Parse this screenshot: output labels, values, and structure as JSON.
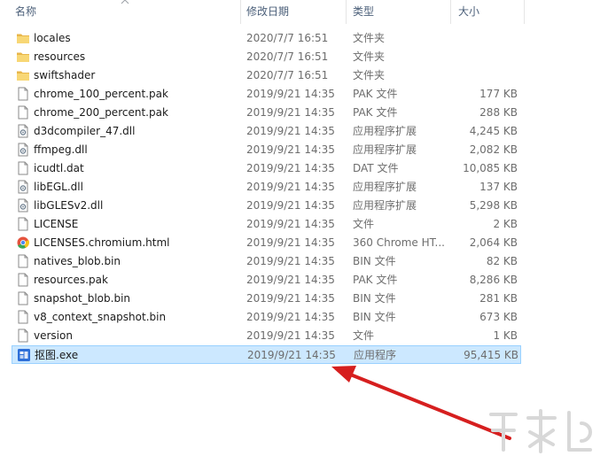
{
  "columns": {
    "name": "名称",
    "date": "修改日期",
    "type": "类型",
    "size": "大小"
  },
  "files": [
    {
      "name": "locales",
      "date": "2020/7/7 16:51",
      "type": "文件夹",
      "size": "",
      "icon": "folder-icon"
    },
    {
      "name": "resources",
      "date": "2020/7/7 16:51",
      "type": "文件夹",
      "size": "",
      "icon": "folder-icon"
    },
    {
      "name": "swiftshader",
      "date": "2020/7/7 16:51",
      "type": "文件夹",
      "size": "",
      "icon": "folder-icon"
    },
    {
      "name": "chrome_100_percent.pak",
      "date": "2019/9/21 14:35",
      "type": "PAK 文件",
      "size": "177 KB",
      "icon": "file-icon"
    },
    {
      "name": "chrome_200_percent.pak",
      "date": "2019/9/21 14:35",
      "type": "PAK 文件",
      "size": "288 KB",
      "icon": "file-icon"
    },
    {
      "name": "d3dcompiler_47.dll",
      "date": "2019/9/21 14:35",
      "type": "应用程序扩展",
      "size": "4,245 KB",
      "icon": "dll-icon"
    },
    {
      "name": "ffmpeg.dll",
      "date": "2019/9/21 14:35",
      "type": "应用程序扩展",
      "size": "2,082 KB",
      "icon": "dll-icon"
    },
    {
      "name": "icudtl.dat",
      "date": "2019/9/21 14:35",
      "type": "DAT 文件",
      "size": "10,085 KB",
      "icon": "file-icon"
    },
    {
      "name": "libEGL.dll",
      "date": "2019/9/21 14:35",
      "type": "应用程序扩展",
      "size": "137 KB",
      "icon": "dll-icon"
    },
    {
      "name": "libGLESv2.dll",
      "date": "2019/9/21 14:35",
      "type": "应用程序扩展",
      "size": "5,298 KB",
      "icon": "dll-icon"
    },
    {
      "name": "LICENSE",
      "date": "2019/9/21 14:35",
      "type": "文件",
      "size": "2 KB",
      "icon": "file-icon"
    },
    {
      "name": "LICENSES.chromium.html",
      "date": "2019/9/21 14:35",
      "type": "360 Chrome HT...",
      "size": "2,064 KB",
      "icon": "chrome-html-icon"
    },
    {
      "name": "natives_blob.bin",
      "date": "2019/9/21 14:35",
      "type": "BIN 文件",
      "size": "82 KB",
      "icon": "file-icon"
    },
    {
      "name": "resources.pak",
      "date": "2019/9/21 14:35",
      "type": "PAK 文件",
      "size": "8,286 KB",
      "icon": "file-icon"
    },
    {
      "name": "snapshot_blob.bin",
      "date": "2019/9/21 14:35",
      "type": "BIN 文件",
      "size": "281 KB",
      "icon": "file-icon"
    },
    {
      "name": "v8_context_snapshot.bin",
      "date": "2019/9/21 14:35",
      "type": "BIN 文件",
      "size": "673 KB",
      "icon": "file-icon"
    },
    {
      "name": "version",
      "date": "2019/9/21 14:35",
      "type": "文件",
      "size": "1 KB",
      "icon": "file-icon"
    },
    {
      "name": "抠图.exe",
      "date": "2019/9/21 14:35",
      "type": "应用程序",
      "size": "95,415 KB",
      "icon": "app-exe-icon",
      "selected": true
    }
  ],
  "colors": {
    "selection_bg": "#cce8ff",
    "selection_border": "#99d1ff",
    "arrow": "#d61f1f",
    "folder": "#f8d775"
  }
}
